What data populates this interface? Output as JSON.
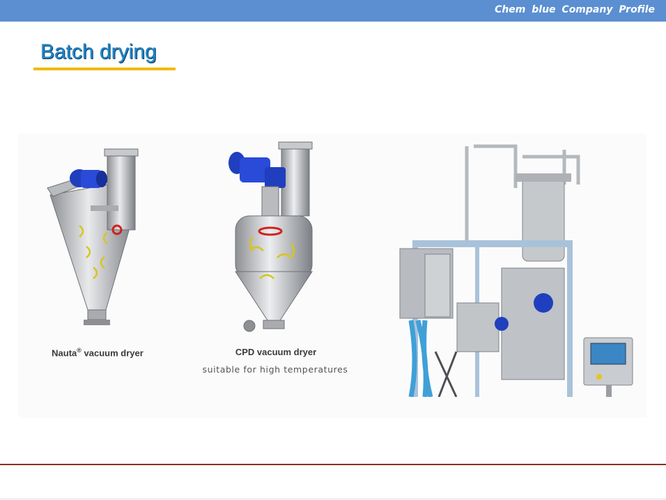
{
  "header": {
    "brand": "Chem blue Company Profile"
  },
  "slide": {
    "title": "Batch drying"
  },
  "figures": {
    "nauta": {
      "caption_main": "Nauta",
      "caption_reg": "®",
      "caption_rest": " vacuum dryer"
    },
    "cpd": {
      "caption": "CPD vacuum dryer",
      "subcaption": "suitable for high temperatures"
    }
  },
  "colors": {
    "header_bar": "#5b8fd2",
    "title": "#1b86c8",
    "title_underline": "#f2b900",
    "footer_line": "#8a2e1e"
  }
}
